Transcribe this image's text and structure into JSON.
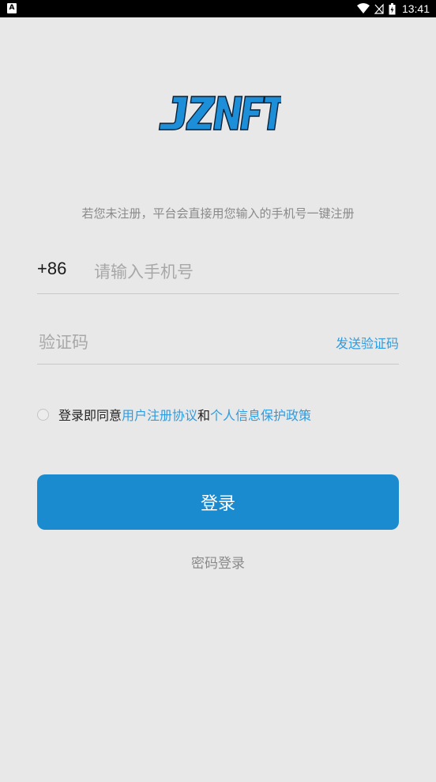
{
  "status_bar": {
    "time": "13:41",
    "left_icon": "A",
    "icons": [
      "wifi-icon",
      "no-signal-icon",
      "battery-charging-icon"
    ]
  },
  "logo": {
    "text": "JZNFT",
    "color": "#1d8fd9"
  },
  "notice": "若您未注册，平台会直接用您输入的手机号一键注册",
  "phone": {
    "prefix": "+86",
    "placeholder": "请输入手机号",
    "value": ""
  },
  "code": {
    "placeholder": "验证码",
    "value": "",
    "send_label": "发送验证码"
  },
  "agreement": {
    "prefix": "登录即同意",
    "user_agreement": "用户注册协议",
    "and": "和",
    "privacy_policy": "个人信息保护政策",
    "checked": false
  },
  "login_button": "登录",
  "password_login": "密码登录",
  "colors": {
    "accent": "#1b8bd0",
    "link": "#2e9ce0",
    "background": "#e8e8e8"
  }
}
